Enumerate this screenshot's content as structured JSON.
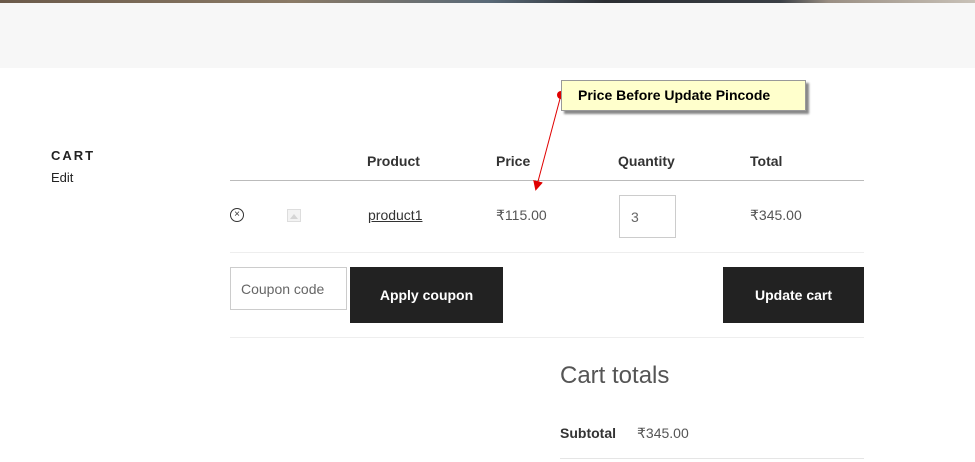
{
  "page": {
    "title": "CART",
    "edit_label": "Edit"
  },
  "cart_table": {
    "headers": {
      "product": "Product",
      "price": "Price",
      "quantity": "Quantity",
      "total": "Total"
    },
    "rows": [
      {
        "remove_icon": "remove-circle-icon",
        "thumbnail_icon": "image-placeholder-icon",
        "product": "product1",
        "price": "₹115.00",
        "quantity": "3",
        "total": "₹345.00"
      }
    ]
  },
  "actions": {
    "coupon_placeholder": "Coupon code",
    "apply_coupon_label": "Apply coupon",
    "update_cart_label": "Update cart"
  },
  "cart_totals": {
    "title": "Cart totals",
    "subtotal_label": "Subtotal",
    "subtotal_value": "₹345.00"
  },
  "annotation": {
    "text": "Price Before Update Pincode",
    "color": "#e00000",
    "background": "#ffffcc"
  },
  "colors": {
    "button_bg": "#222222",
    "button_text": "#ffffff",
    "header_band": "#f7f7f7"
  }
}
